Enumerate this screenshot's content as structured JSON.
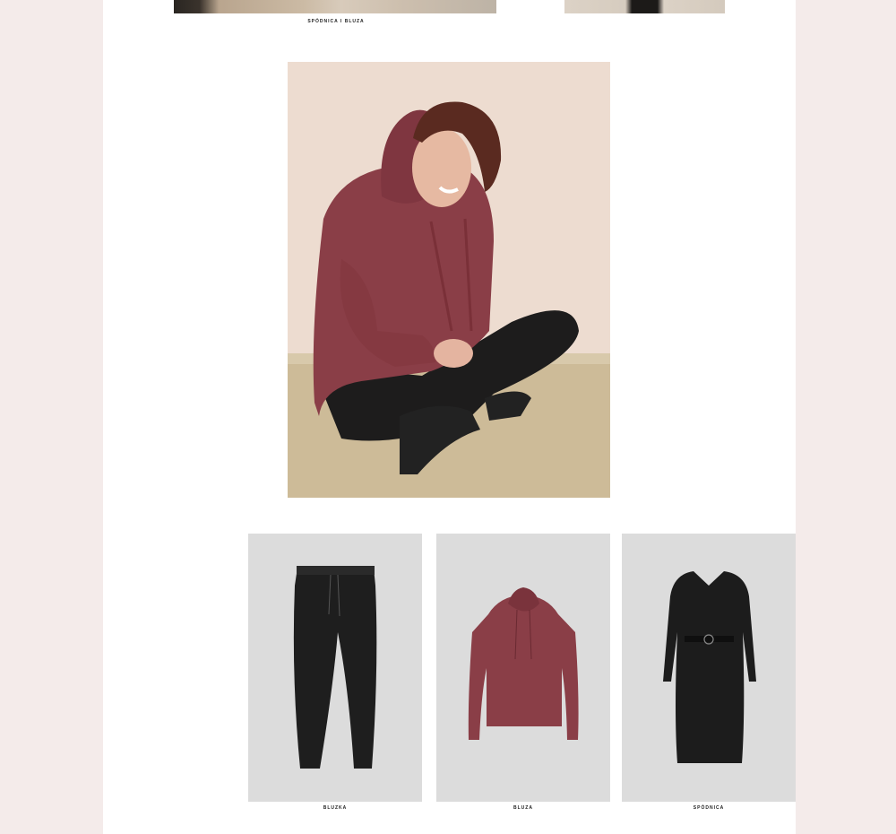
{
  "top_row": {
    "caption_left": "SPÓDNICA  I  BLUZA"
  },
  "hero": {
    "alt": "woman in hoodie"
  },
  "products": [
    {
      "caption": "BLUZKA"
    },
    {
      "caption": "BLUZA"
    },
    {
      "caption": "SPÓDNICA"
    }
  ],
  "colors": {
    "background": "#f4ebea",
    "content": "#ffffff",
    "product_bg": "#dcdcdc",
    "hoodie": "#8a3e47"
  }
}
